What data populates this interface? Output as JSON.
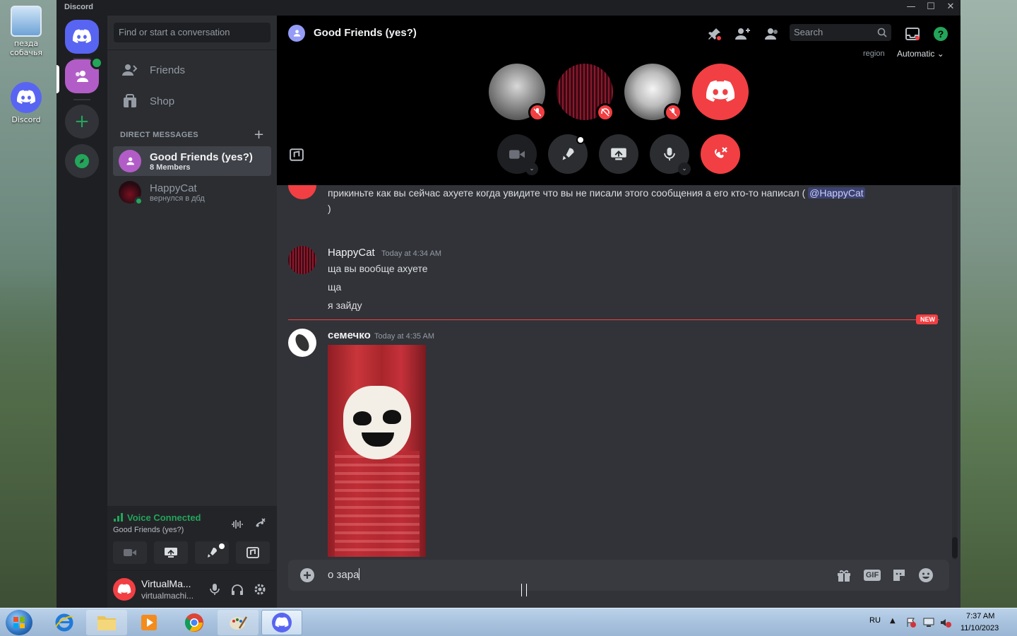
{
  "desktop": {
    "icons": [
      {
        "label": "пезда собачья"
      },
      {
        "label": "Discord"
      }
    ]
  },
  "window": {
    "title": "Discord",
    "controls": {
      "minimize": "—",
      "maximize": "☐",
      "close": "✕"
    }
  },
  "sidebar": {
    "search_placeholder": "Find or start a conversation",
    "nav": [
      {
        "label": "Friends"
      },
      {
        "label": "Shop"
      }
    ],
    "dm_header": "DIRECT MESSAGES",
    "dm_add": "+",
    "dms": [
      {
        "name": "Good Friends (yes?)",
        "sub": "8 Members"
      },
      {
        "name": "HappyCat",
        "sub": "вернулся в дбд"
      }
    ],
    "voice": {
      "status": "Voice Connected",
      "channel": "Good Friends (yes?)"
    },
    "user": {
      "name": "VirtualMa...",
      "tag": "virtualmachi..."
    }
  },
  "call": {
    "title": "Good Friends (yes?)",
    "search_placeholder": "Search",
    "region_label": "region",
    "region_value": "Automatic"
  },
  "messages": {
    "partial": {
      "text": "прикиньте как вы сейчас ахуете когда увидите что вы не писали этого сообщения а его кто-то написал (",
      "mention": "@HappyCat",
      "tail": ")"
    },
    "group1": {
      "author": "HappyCat",
      "time": "Today at 4:34 AM",
      "lines": [
        "ща вы вообще ахуете",
        "ща",
        "я зайду"
      ]
    },
    "new_badge": "NEW",
    "group2": {
      "author": "семечко",
      "time": "Today at 4:35 AM"
    }
  },
  "composer": {
    "value": "о зара",
    "gif_label": "GIF"
  },
  "taskbar": {
    "lang": "RU",
    "time": "7:37 AM",
    "date": "11/10/2023"
  },
  "colors": {
    "blurple": "#5865f2",
    "green": "#23a55a",
    "red": "#f23f43",
    "bg_main": "#313338",
    "bg_sidebar": "#2b2d31"
  }
}
